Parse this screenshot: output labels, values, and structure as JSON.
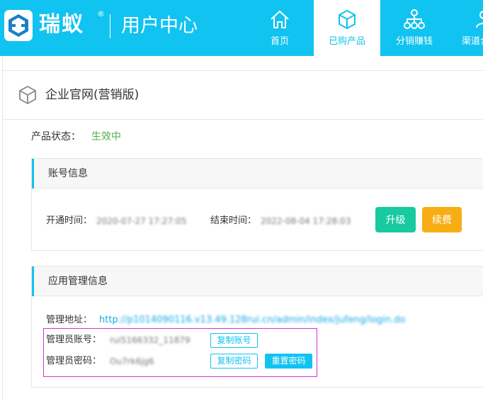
{
  "header": {
    "brand": "瑞蚁",
    "brand_mark": "®",
    "subtitle": "用户中心",
    "nav": [
      {
        "label": "首页",
        "icon": "home-icon"
      },
      {
        "label": "已购产品",
        "icon": "box-icon",
        "active": true
      },
      {
        "label": "分销赚钱",
        "icon": "share-network-icon"
      },
      {
        "label": "渠道合",
        "icon": "channel-icon"
      }
    ],
    "color": "#11c3f0"
  },
  "product": {
    "title": "企业官网(营销版)",
    "icon": "box-outline-icon",
    "status_label": "产品状态：",
    "status_value": "生效中"
  },
  "account_panel": {
    "title": "账号信息",
    "open_time_label": "开通时间：",
    "open_time_value": "2020-07-27 17:27:05",
    "end_time_label": "结束时间：",
    "end_time_value": "2022-08-04 17:28:03",
    "upgrade_label": "升级",
    "renew_label": "续费"
  },
  "app_panel": {
    "title": "应用管理信息",
    "admin_url_label": "管理地址：",
    "admin_url_prefix": "http",
    "admin_url_rest": "://p1014090116.v13.49.128rui.cn/admin/index/jufeng/login.do",
    "admin_account_label": "管理员账号：",
    "admin_account_value": "rui5166332_11879",
    "copy_account_label": "复制账号",
    "admin_password_label": "管理员密码：",
    "admin_password_value": "Ou7rk6jg6",
    "copy_password_label": "复制密码",
    "reset_password_label": "重置密码"
  }
}
